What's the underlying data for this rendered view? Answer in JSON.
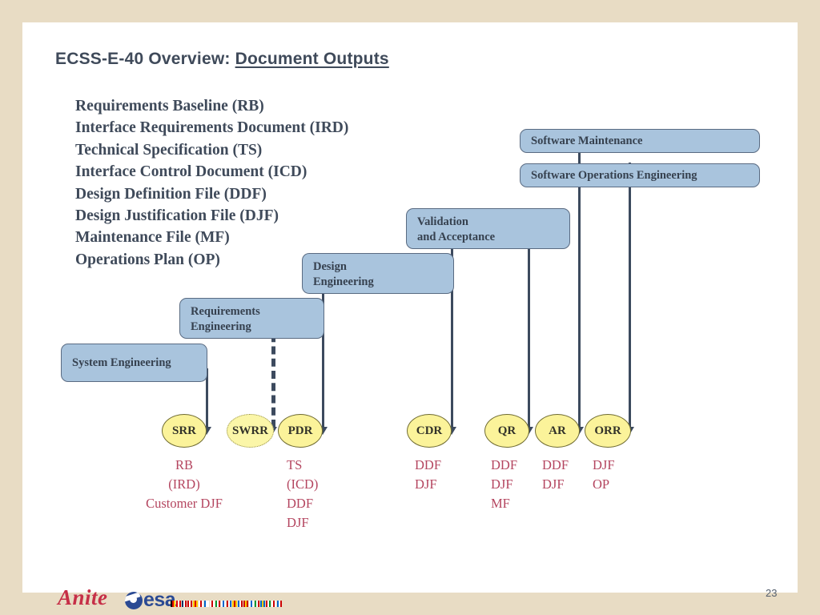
{
  "slide": {
    "title_main": "ECSS-E-40 Overview: ",
    "title_underlined": "Document Outputs",
    "page_number": "23"
  },
  "documents": {
    "items": [
      "Requirements Baseline (RB)",
      "Interface Requirements Document (IRD)",
      "Technical Specification (TS)",
      "Interface Control Document (ICD)",
      "Design Definition File (DDF)",
      "Design Justification File (DJF)",
      "Maintenance File (MF)",
      "Operations Plan (OP)"
    ]
  },
  "process_boxes": [
    {
      "id": "software-maintenance",
      "label": "Software Maintenance"
    },
    {
      "id": "software-operations-engineering",
      "label": "Software Operations Engineering"
    },
    {
      "id": "validation-and-acceptance",
      "label": "Validation\nand Acceptance"
    },
    {
      "id": "design-engineering",
      "label": "Design\nEngineering"
    },
    {
      "id": "requirements-engineering",
      "label": "Requirements\nEngineering"
    },
    {
      "id": "system-engineering",
      "label": "System Engineering"
    }
  ],
  "milestones": [
    {
      "id": "srr",
      "label": "SRR",
      "style": "solid"
    },
    {
      "id": "swrr",
      "label": "SWRR",
      "style": "dotted"
    },
    {
      "id": "pdr",
      "label": "PDR",
      "style": "solid"
    },
    {
      "id": "cdr",
      "label": "CDR",
      "style": "solid"
    },
    {
      "id": "qr",
      "label": "QR",
      "style": "solid"
    },
    {
      "id": "ar",
      "label": "AR",
      "style": "solid"
    },
    {
      "id": "orr",
      "label": "ORR",
      "style": "solid"
    }
  ],
  "outputs": [
    {
      "for": "srr",
      "text": "RB\n(IRD)\nCustomer DJF"
    },
    {
      "for": "pdr",
      "text": "TS\n(ICD)\nDDF\nDJF"
    },
    {
      "for": "cdr",
      "text": "DDF\nDJF"
    },
    {
      "for": "qr",
      "text": "DDF\nDJF\nMF"
    },
    {
      "for": "ar",
      "text": "DDF\nDJF"
    },
    {
      "for": "orr",
      "text": "DJF\nOP"
    }
  ],
  "footer": {
    "anite_logo_text": "Anite",
    "esa_logo_text": "esa"
  },
  "colors": {
    "frame": "#e8dcc4",
    "slide": "#ffffff",
    "box_fill": "#a9c4dd",
    "box_border": "#5a6b82",
    "oval_fill": "#fbf39a",
    "oval_border": "#6f6b32",
    "connector": "#3c4a5e",
    "title_text": "#3f4a5a",
    "output_text": "#b4455f",
    "anite_red": "#c62f47",
    "esa_blue": "#2b4a93"
  }
}
